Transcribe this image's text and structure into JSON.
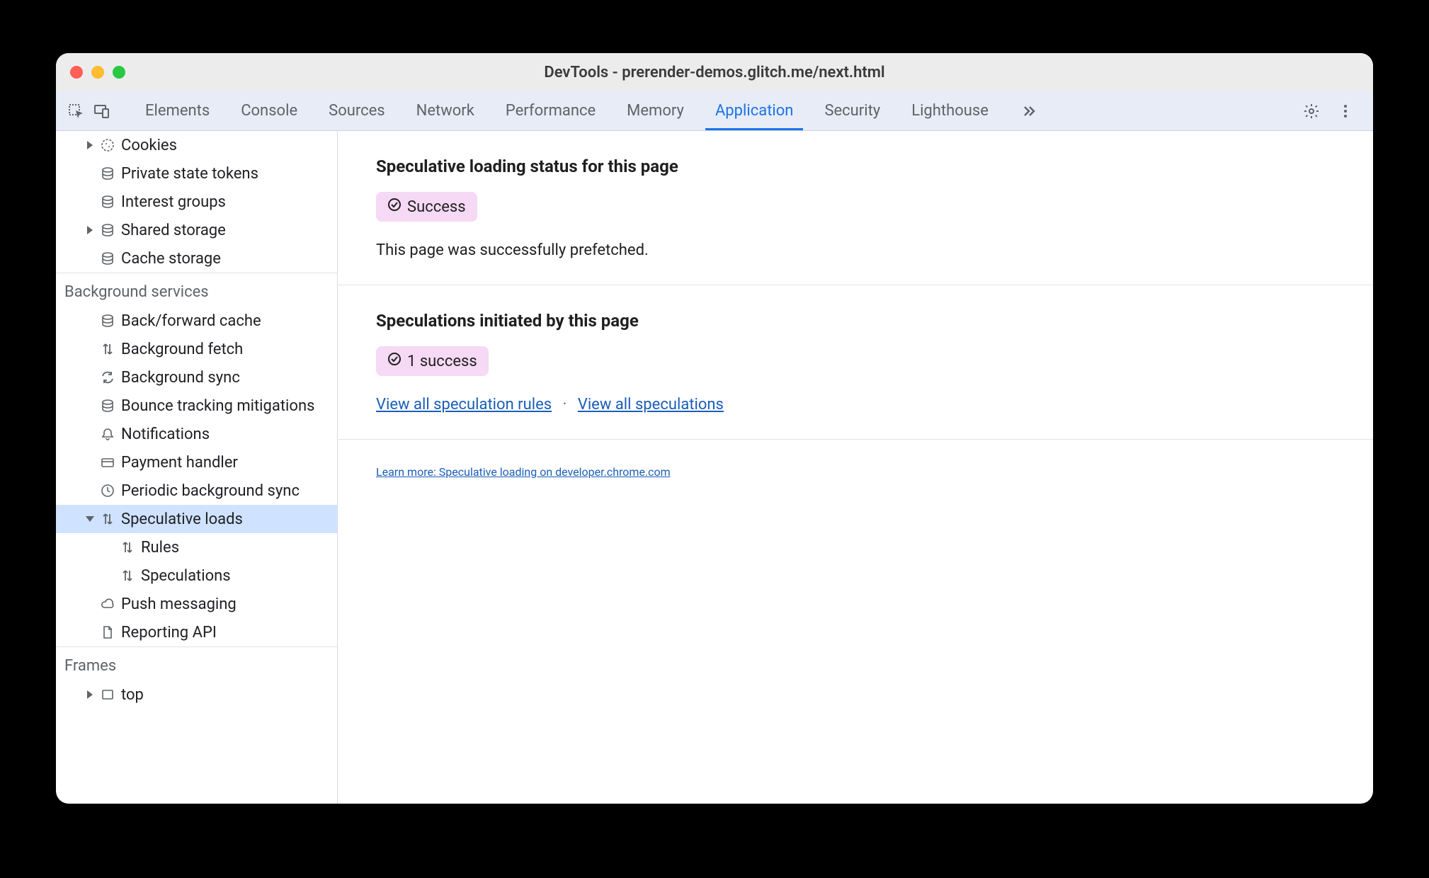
{
  "window": {
    "title": "DevTools - prerender-demos.glitch.me/next.html"
  },
  "tabs": {
    "items": [
      "Elements",
      "Console",
      "Sources",
      "Network",
      "Performance",
      "Memory",
      "Application",
      "Security",
      "Lighthouse"
    ],
    "active": "Application"
  },
  "sidebar": {
    "storage": {
      "cookies": "Cookies",
      "private_tokens": "Private state tokens",
      "interest_groups": "Interest groups",
      "shared_storage": "Shared storage",
      "cache_storage": "Cache storage"
    },
    "bg_header": "Background services",
    "bg": {
      "bfcache": "Back/forward cache",
      "bg_fetch": "Background fetch",
      "bg_sync": "Background sync",
      "bounce": "Bounce tracking mitigations",
      "notifications": "Notifications",
      "payment": "Payment handler",
      "periodic": "Periodic background sync",
      "speculative": "Speculative loads",
      "rules": "Rules",
      "speculations": "Speculations",
      "push": "Push messaging",
      "reporting": "Reporting API"
    },
    "frames_header": "Frames",
    "frames": {
      "top": "top"
    }
  },
  "panel": {
    "status": {
      "title": "Speculative loading status for this page",
      "badge": "Success",
      "desc": "This page was successfully prefetched."
    },
    "initiated": {
      "title": "Speculations initiated by this page",
      "badge": "1 success",
      "link_rules": "View all speculation rules",
      "link_specs": "View all speculations"
    },
    "learn_more": "Learn more: Speculative loading on developer.chrome.com"
  }
}
